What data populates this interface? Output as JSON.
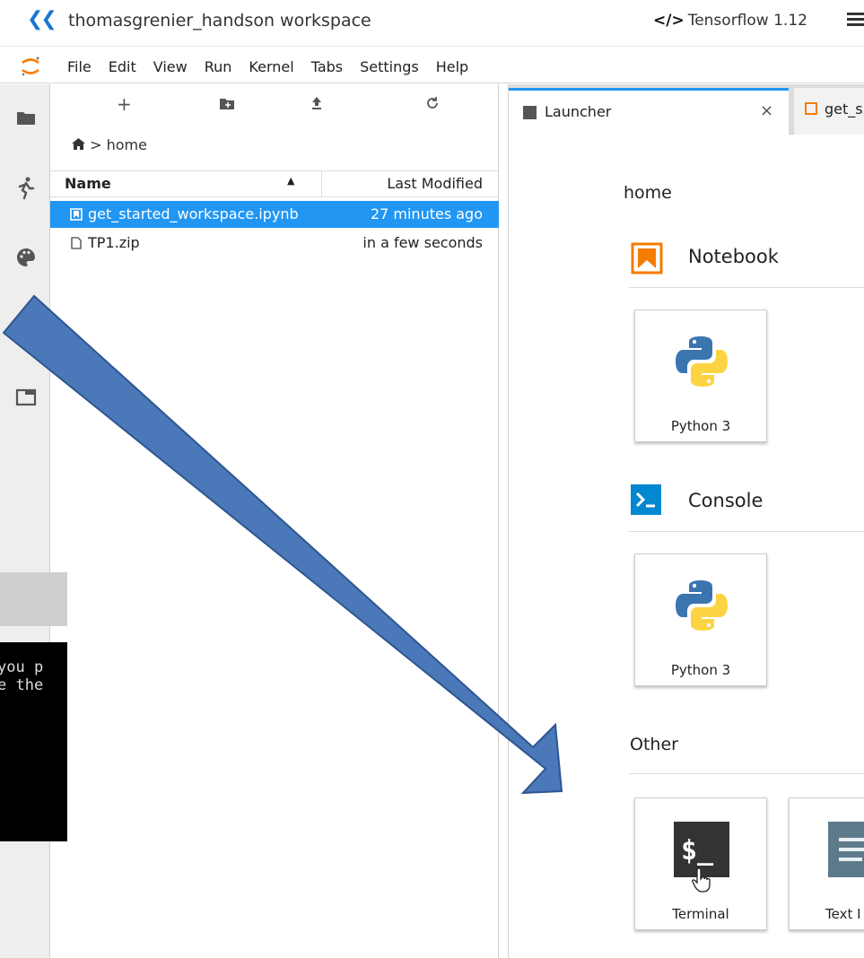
{
  "topbar": {
    "workspace_title": "thomasgrenier_handson workspace",
    "environment_tag": "</>",
    "environment_name": "Tensorflow 1.12"
  },
  "menubar": {
    "items": [
      "File",
      "Edit",
      "View",
      "Run",
      "Kernel",
      "Tabs",
      "Settings",
      "Help"
    ]
  },
  "filebrowser": {
    "toolbar": {
      "new_launcher": "+",
      "new_folder": "new-folder-icon",
      "upload": "upload-icon",
      "refresh": "refresh-icon"
    },
    "breadcrumb": {
      "root_icon": "home-icon",
      "separator": ">",
      "path": "home"
    },
    "columns": {
      "name": "Name",
      "modified": "Last Modified"
    },
    "files": [
      {
        "name": "get_started_workspace.ipynb",
        "modified": "27 minutes ago",
        "selected": true,
        "icon": "notebook-icon"
      },
      {
        "name": "TP1.zip",
        "modified": "in a few seconds",
        "selected": false,
        "icon": "file-icon"
      }
    ]
  },
  "background_terminal": {
    "line1": "you p",
    "line2": "e the"
  },
  "tabs": [
    {
      "label": "Launcher",
      "close": "×",
      "active": true
    },
    {
      "label": "get_s",
      "active": false
    }
  ],
  "launcher": {
    "cwd": "home",
    "sections": {
      "notebook": {
        "title": "Notebook",
        "cards": [
          {
            "label": "Python 3"
          }
        ]
      },
      "console": {
        "title": "Console",
        "icon_text": ">_",
        "cards": [
          {
            "label": "Python 3"
          }
        ]
      },
      "other": {
        "title": "Other",
        "cards": [
          {
            "label": "Terminal",
            "icon_text": "$_"
          },
          {
            "label": "Text I"
          }
        ]
      }
    }
  },
  "colors": {
    "accent": "#2196f3",
    "notebook": "#f57c00",
    "console": "#0288d1",
    "terminal": "#333333",
    "arrow": "#4a78b8"
  }
}
